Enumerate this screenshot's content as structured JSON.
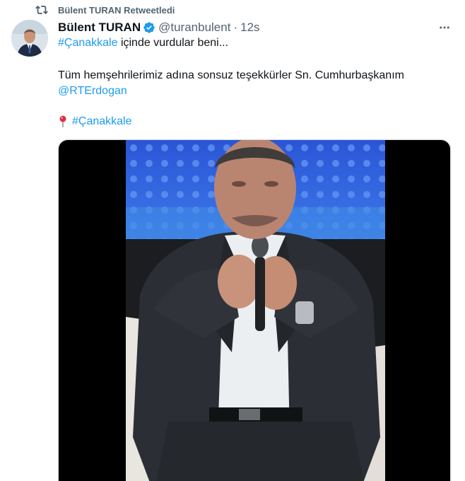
{
  "retweet": {
    "icon": "retweet-icon",
    "text": "Bülent TURAN Retweetledi"
  },
  "tweet": {
    "author_name": "Bülent TURAN",
    "verified_icon": "verified-badge-icon",
    "handle": "@turanbulent",
    "separator": "·",
    "time": "12s",
    "line1_hashtag": "#Çanakkale",
    "line1_text": " içinde vurdular beni...",
    "line2_text": "Tüm hemşehrilerimiz adına sonsuz teşekkürler Sn. Cumhurbaşkanım",
    "mention": "@RTErdogan",
    "pin_icon": "round-pushpin-icon",
    "line4_hashtag": "#Çanakkale"
  },
  "colors": {
    "link": "#1d9bf0",
    "secondary_text": "#536471",
    "primary_text": "#0f1419"
  }
}
